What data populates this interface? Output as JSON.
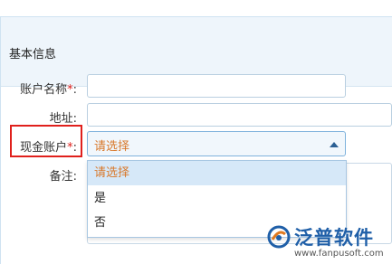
{
  "panel": {
    "title": "基本信息"
  },
  "fields": {
    "account_name": {
      "label": "账户名称",
      "required": "*",
      "colon": ":"
    },
    "address": {
      "label": "地址:"
    },
    "cash_account": {
      "label": "现金账户",
      "required": "*",
      "colon": ":",
      "selected": "请选择"
    },
    "remark": {
      "label": "备注:"
    }
  },
  "dropdown": {
    "options": [
      "请选择",
      "是",
      "否"
    ]
  },
  "logo": {
    "name": "泛普软件",
    "url": "www.fanpusoft.com"
  },
  "colors": {
    "accent": "#1f5fa8",
    "required": "#e0201c",
    "placeholder": "#d8782a",
    "highlight": "#e0201c"
  },
  "icons": {
    "select_caret": "caret-up-icon",
    "logo": "fanpu-logo-icon"
  }
}
